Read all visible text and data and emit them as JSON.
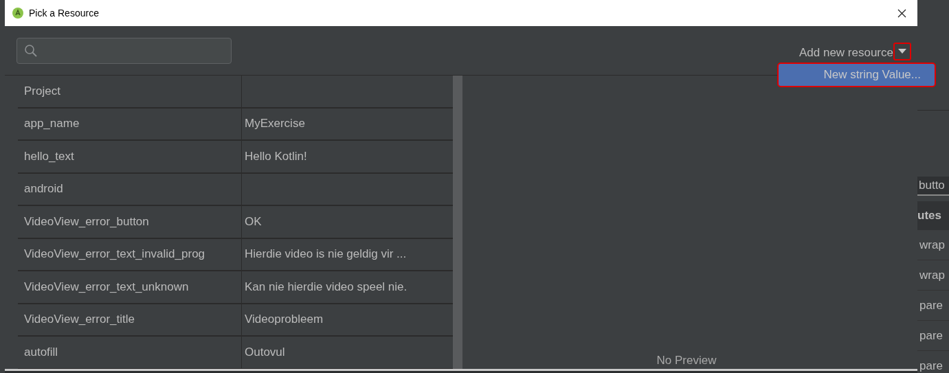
{
  "window": {
    "title": "Pick a Resource"
  },
  "add_resource": {
    "label": "Add new resource",
    "annotated": true
  },
  "menu": {
    "items": [
      {
        "label": "New string Value...",
        "selected": true,
        "annotated": true
      }
    ]
  },
  "table": {
    "rows": [
      {
        "kind": "group",
        "name": "Project"
      },
      {
        "kind": "string",
        "name": "app_name",
        "value": "MyExercise"
      },
      {
        "kind": "string",
        "name": "hello_text",
        "value": "Hello Kotlin!"
      },
      {
        "kind": "group",
        "name": "android"
      },
      {
        "kind": "string",
        "name": "VideoView_error_button",
        "value": "OK"
      },
      {
        "kind": "string",
        "name": "VideoView_error_text_invalid_prog",
        "value": "Hierdie video is nie geldig vir ..."
      },
      {
        "kind": "string",
        "name": "VideoView_error_text_unknown",
        "value": "Kan nie hierdie video speel nie."
      },
      {
        "kind": "string",
        "name": "VideoView_error_title",
        "value": "Videoprobleem"
      },
      {
        "kind": "string",
        "name": "autofill",
        "value": "Outovul"
      }
    ]
  },
  "preview": {
    "text": "No Preview"
  },
  "background_ide": {
    "items": [
      {
        "kind": "field",
        "text": "butto"
      },
      {
        "kind": "header",
        "text": "utes"
      },
      {
        "kind": "cell",
        "text": "wrap"
      },
      {
        "kind": "cell",
        "text": "wrap"
      },
      {
        "kind": "cell",
        "text": "pare"
      },
      {
        "kind": "cell",
        "text": "pare"
      },
      {
        "kind": "cell",
        "text": "pare"
      }
    ]
  }
}
